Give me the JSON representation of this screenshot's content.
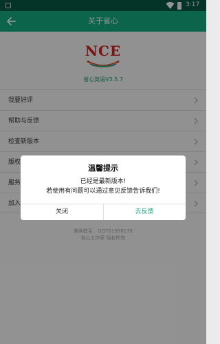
{
  "status_bar": {
    "time": "3:17"
  },
  "app_bar": {
    "title": "关于省心"
  },
  "about": {
    "logo_text": "NCE",
    "version": "省心英语V3.5.7"
  },
  "menu": {
    "items": [
      {
        "label": "我要好评"
      },
      {
        "label": "帮助与反馈"
      },
      {
        "label": "检查新版本"
      },
      {
        "label": "版权说明"
      },
      {
        "label": "服务条款"
      },
      {
        "label": "加入我们"
      }
    ]
  },
  "footer": {
    "contact": "商务联系：QQ761998178",
    "copyright": "省心工作室 版权所有"
  },
  "dialog": {
    "title": "温馨提示",
    "line1": "已经是最新版本!",
    "line2": "若使用有问题可以通过意见反馈告诉我们!",
    "close_label": "关闭",
    "feedback_label": "去反馈"
  },
  "colors": {
    "accent": "#14a278",
    "status_bar": "#06543f",
    "logo_red": "#c0201c"
  }
}
